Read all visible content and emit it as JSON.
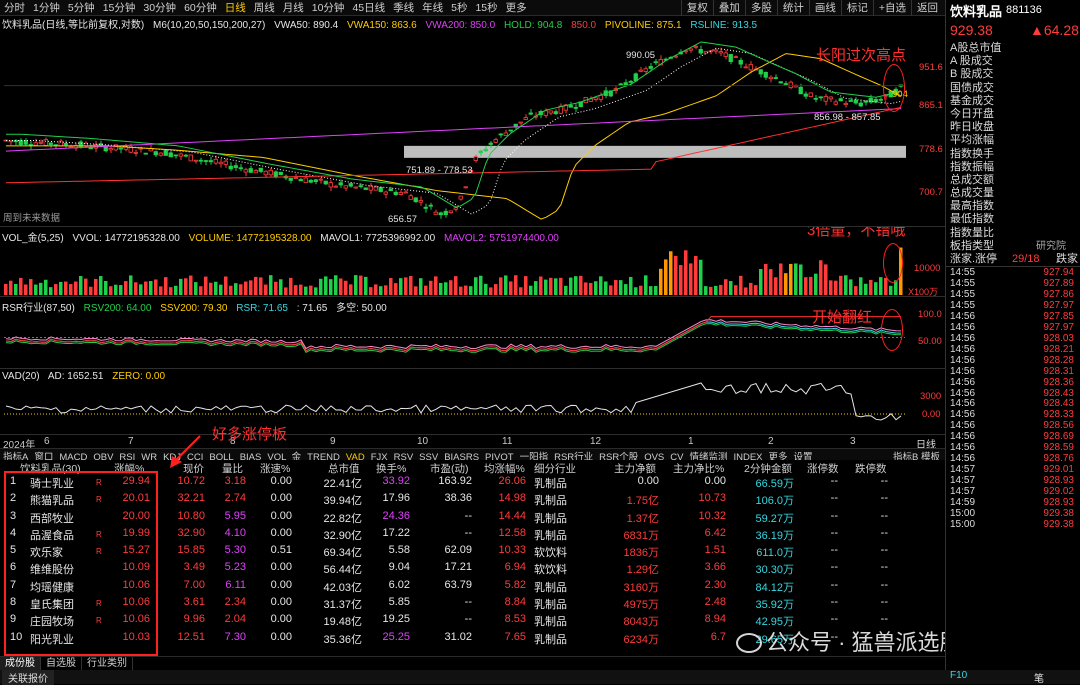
{
  "topbar": {
    "periods": [
      "分时",
      "1分钟",
      "5分钟",
      "15分钟",
      "30分钟",
      "60分钟",
      "日线",
      "周线",
      "月线",
      "10分钟",
      "45日线",
      "季线",
      "年线",
      "5秒",
      "15秒",
      "更多"
    ],
    "active_period": "日线",
    "tools": [
      "复权",
      "叠加",
      "多股",
      "统计",
      "画线",
      "标记",
      "+自选",
      "返回"
    ]
  },
  "main_legend": {
    "title": "饮料乳品(日线,等比前复权,对数)",
    "ma": "M6(10,20,50,150,200,27)",
    "vwa50": "VWA50: 890.4",
    "vwa150": "VWA150: 863.6",
    "vwa200": "VWA200: 850.0",
    "hold": "HOLD: 904.8",
    "val850": "850.0",
    "pivot": "PIVOLINE: 875.1",
    "rsline": "RSLINE: 913.5"
  },
  "main_chart": {
    "yticks": [
      "951.6",
      "865.1",
      "778.6",
      "700.7"
    ],
    "labels": {
      "high": "990.05",
      "low": "656.57",
      "range_low": "751.89 - 778.53",
      "recent": "856.98 - 857.85",
      "last": "904",
      "future_note": "周到未来数据"
    }
  },
  "vol_legend": {
    "title": "VOL_金(5,25)",
    "vvol": "VVOL: 14772195328.00",
    "volume": "VOLUME: 14772195328.00",
    "mavol1": "MAVOL1: 7725396992.00",
    "mavol2": "MAVOL2: 5751974400.00",
    "yticks": [
      "10000",
      "X100万"
    ]
  },
  "rsr_legend": {
    "title": "RSR行业(87,50)",
    "rsv200": "RSV200: 64.00",
    "ssv200": "SSV200: 79.30",
    "rsr": "RSR: 71.65",
    "val": ": 71.65",
    "duokong": "多空: 50.00",
    "yticks": [
      "100.0",
      "50.00"
    ]
  },
  "vad_legend": {
    "title": "VAD(20)",
    "ad": "AD: 1652.51",
    "zero": "ZERO: 0.00",
    "yticks": [
      "3000",
      "0.00"
    ]
  },
  "xaxis": {
    "labels": [
      "2024年",
      "6",
      "7",
      "8",
      "9",
      "10",
      "11",
      "12",
      "1",
      "2",
      "3"
    ],
    "right": "日线"
  },
  "indicator_tabs": {
    "items": [
      "指标A",
      "窗口",
      "MACD",
      "OBV",
      "RSI",
      "WR",
      "KDJ",
      "CCI",
      "BOLL",
      "BIAS",
      "VOL_金",
      "TREND",
      "VAD",
      "FJX",
      "RSV",
      "SSV",
      "BIASRS",
      "PIVOT",
      "一阳指",
      "RSR行业",
      "RSR个股",
      "OVS",
      "CV",
      "情绪监测",
      "INDEX",
      "更多",
      "设置"
    ],
    "active": "VAD",
    "right": "指标B  模板"
  },
  "table": {
    "headers": [
      "饮料乳品(30)",
      "涨幅%",
      "现价",
      "量比",
      "涨速%",
      "总市值",
      "换手%",
      "市盈(动)",
      "均涨幅%",
      "细分行业",
      "主力净额",
      "主力净比%",
      "2分钟金额",
      "涨停数",
      "跌停数"
    ],
    "rows": [
      {
        "idx": "1",
        "name": "骑士乳业",
        "flag": "R",
        "chg": "29.94",
        "price": "10.72",
        "lb": "3.18",
        "spd": "0.00",
        "mcap": "22.41亿",
        "turn": "33.92",
        "pe": "163.92",
        "avg": "26.06",
        "ind": "乳制品",
        "net": "0.00",
        "ratio": "0.00",
        "amt2": "66.59万",
        "zt": "--",
        "dt": "--"
      },
      {
        "idx": "2",
        "name": "熊猫乳品",
        "flag": "R",
        "chg": "20.01",
        "price": "32.21",
        "lb": "2.74",
        "spd": "0.00",
        "mcap": "39.94亿",
        "turn": "17.96",
        "pe": "38.36",
        "avg": "14.98",
        "ind": "乳制品",
        "net": "1.75亿",
        "ratio": "10.73",
        "amt2": "106.0万",
        "zt": "--",
        "dt": "--"
      },
      {
        "idx": "3",
        "name": "西部牧业",
        "flag": "",
        "chg": "20.00",
        "price": "10.80",
        "lb": "5.95",
        "spd": "0.00",
        "mcap": "22.82亿",
        "turn": "24.36",
        "pe": "--",
        "avg": "14.44",
        "ind": "乳制品",
        "net": "1.37亿",
        "ratio": "10.32",
        "amt2": "59.27万",
        "zt": "--",
        "dt": "--"
      },
      {
        "idx": "4",
        "name": "品渥食品",
        "flag": "R",
        "chg": "19.99",
        "price": "32.90",
        "lb": "4.10",
        "spd": "0.00",
        "mcap": "32.90亿",
        "turn": "17.22",
        "pe": "--",
        "avg": "12.58",
        "ind": "乳制品",
        "net": "6831万",
        "ratio": "6.42",
        "amt2": "36.19万",
        "zt": "--",
        "dt": "--"
      },
      {
        "idx": "5",
        "name": "欢乐家",
        "flag": "R",
        "chg": "15.27",
        "price": "15.85",
        "lb": "5.30",
        "spd": "0.51",
        "mcap": "69.34亿",
        "turn": "5.58",
        "pe": "62.09",
        "avg": "10.33",
        "ind": "软饮料",
        "net": "1836万",
        "ratio": "1.51",
        "amt2": "611.0万",
        "zt": "--",
        "dt": "--"
      },
      {
        "idx": "6",
        "name": "维维股份",
        "flag": "",
        "chg": "10.09",
        "price": "3.49",
        "lb": "5.23",
        "spd": "0.00",
        "mcap": "56.44亿",
        "turn": "9.04",
        "pe": "17.21",
        "avg": "6.94",
        "ind": "软饮料",
        "net": "1.29亿",
        "ratio": "3.66",
        "amt2": "30.30万",
        "zt": "--",
        "dt": "--"
      },
      {
        "idx": "7",
        "name": "均瑶健康",
        "flag": "",
        "chg": "10.06",
        "price": "7.00",
        "lb": "6.11",
        "spd": "0.00",
        "mcap": "42.03亿",
        "turn": "6.02",
        "pe": "63.79",
        "avg": "5.82",
        "ind": "乳制品",
        "net": "3160万",
        "ratio": "2.30",
        "amt2": "84.12万",
        "zt": "--",
        "dt": "--"
      },
      {
        "idx": "8",
        "name": "皇氏集团",
        "flag": "R",
        "chg": "10.06",
        "price": "3.61",
        "lb": "2.34",
        "spd": "0.00",
        "mcap": "31.37亿",
        "turn": "5.85",
        "pe": "--",
        "avg": "8.84",
        "ind": "乳制品",
        "net": "4975万",
        "ratio": "2.48",
        "amt2": "35.92万",
        "zt": "--",
        "dt": "--"
      },
      {
        "idx": "9",
        "name": "庄园牧场",
        "flag": "R",
        "chg": "10.06",
        "price": "9.96",
        "lb": "2.04",
        "spd": "0.00",
        "mcap": "19.48亿",
        "turn": "19.25",
        "pe": "--",
        "avg": "8.53",
        "ind": "乳制品",
        "net": "8043万",
        "ratio": "8.94",
        "amt2": "42.95万",
        "zt": "--",
        "dt": "--"
      },
      {
        "idx": "10",
        "name": "阳光乳业",
        "flag": "",
        "chg": "10.03",
        "price": "12.51",
        "lb": "7.30",
        "spd": "0.00",
        "mcap": "35.36亿",
        "turn": "25.25",
        "pe": "31.02",
        "avg": "7.65",
        "ind": "乳制品",
        "net": "6234万",
        "ratio": "6.7",
        "amt2": "29.65万",
        "zt": "--",
        "dt": "--"
      }
    ]
  },
  "bottom_tabs": [
    "成份股",
    "自选股",
    "行业类别"
  ],
  "footer": {
    "left": "关联报价",
    "right": "F10",
    "right2": "笔"
  },
  "side": {
    "name": "饮料乳品",
    "code": "881136",
    "price": "929.38",
    "change": "▲64.28",
    "items": [
      "A股总市值",
      "A 股成交",
      "B 股成交",
      "国债成交",
      "基金成交",
      "今日开盘",
      "昨日收盘",
      "平均涨幅",
      "指数换手",
      "指数振幅",
      "总成交额",
      "总成交量",
      "最高指数",
      "最低指数",
      "指数量比",
      "板指类型",
      "涨家.涨停"
    ],
    "type_val": "研究院",
    "zj": "29/18",
    "dj": "跌家",
    "ticks": [
      [
        "14:55",
        "927.94"
      ],
      [
        "14:55",
        "927.89"
      ],
      [
        "14:55",
        "927.86"
      ],
      [
        "14:55",
        "927.97"
      ],
      [
        "14:56",
        "927.85"
      ],
      [
        "14:56",
        "927.97"
      ],
      [
        "14:56",
        "928.03"
      ],
      [
        "14:56",
        "928.21"
      ],
      [
        "14:56",
        "928.28"
      ],
      [
        "14:56",
        "928.31"
      ],
      [
        "14:56",
        "928.36"
      ],
      [
        "14:56",
        "928.43"
      ],
      [
        "14:56",
        "928.43"
      ],
      [
        "14:56",
        "928.33"
      ],
      [
        "14:56",
        "928.56"
      ],
      [
        "14:56",
        "928.69"
      ],
      [
        "14:56",
        "928.59"
      ],
      [
        "14:56",
        "928.76"
      ],
      [
        "14:57",
        "929.01"
      ],
      [
        "14:57",
        "928.93"
      ],
      [
        "14:57",
        "929.02"
      ],
      [
        "14:59",
        "928.93"
      ],
      [
        "15:00",
        "929.38"
      ],
      [
        "15:00",
        "929.38"
      ]
    ]
  },
  "annotations": {
    "a1": "长阳过次高点",
    "a2": "3倍量，不错哦",
    "a3": "开始翻红",
    "a4": "好多涨停板"
  },
  "watermark": "公众号 · 猛兽派选股",
  "colors": {
    "up": "#ff3c3c",
    "down": "#21d04a",
    "accent": "#ffcc00",
    "anno": "#ff2020",
    "bg": "#000000"
  }
}
